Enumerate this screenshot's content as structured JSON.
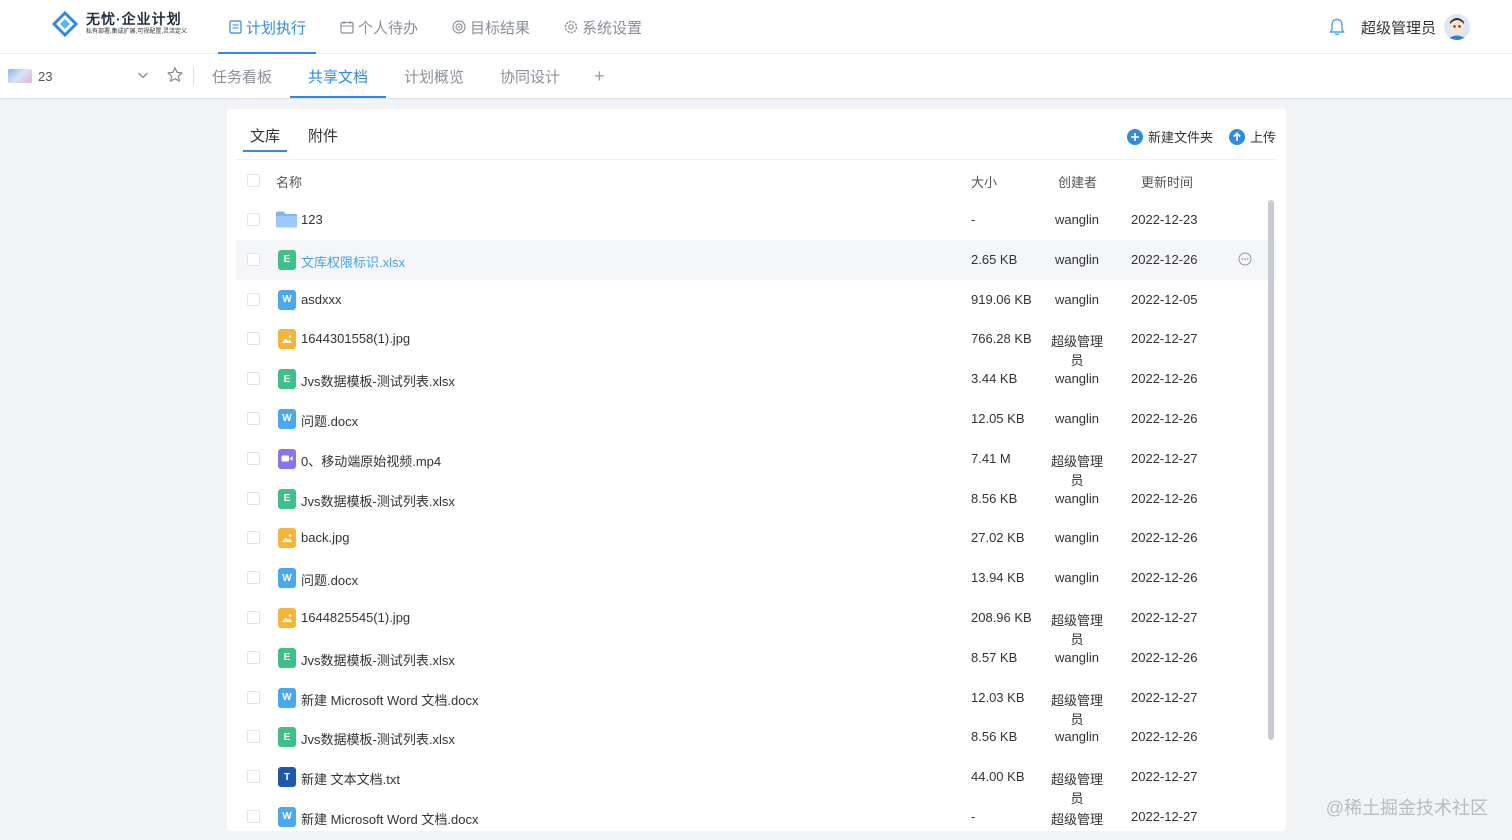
{
  "brand": {
    "title": "无忧·企业计划",
    "subtitle": "私有部署,集成扩展,可视配置,灵活定义"
  },
  "nav": [
    {
      "label": "计划执行",
      "icon": "document-icon",
      "active": true
    },
    {
      "label": "个人待办",
      "icon": "calendar-icon",
      "active": false
    },
    {
      "label": "目标结果",
      "icon": "target-icon",
      "active": false
    },
    {
      "label": "系统设置",
      "icon": "gear-icon",
      "active": false
    }
  ],
  "user": {
    "name": "超级管理员"
  },
  "project": {
    "name": "23"
  },
  "tabs": [
    {
      "label": "任务看板",
      "active": false
    },
    {
      "label": "共享文档",
      "active": true
    },
    {
      "label": "计划概览",
      "active": false
    },
    {
      "label": "协同设计",
      "active": false
    }
  ],
  "tab_add": "+",
  "library_tabs": [
    {
      "label": "文库",
      "active": true
    },
    {
      "label": "附件",
      "active": false
    }
  ],
  "actions": {
    "new_folder": "新建文件夹",
    "upload": "上传"
  },
  "columns": {
    "name": "名称",
    "size": "大小",
    "creator": "创建者",
    "updated": "更新时间"
  },
  "files": [
    {
      "name": "123",
      "type": "folder",
      "size": "-",
      "creator": "wanglin",
      "date": "2022-12-23"
    },
    {
      "name": "文库权限标识.xlsx",
      "type": "excel",
      "size": "2.65 KB",
      "creator": "wanglin",
      "date": "2022-12-26",
      "hover": true
    },
    {
      "name": "asdxxx",
      "type": "word",
      "size": "919.06 KB",
      "creator": "wanglin",
      "date": "2022-12-05"
    },
    {
      "name": "1644301558(1).jpg",
      "type": "image",
      "size": "766.28 KB",
      "creator": "超级管理员",
      "date": "2022-12-27"
    },
    {
      "name": "Jvs数据模板-测试列表.xlsx",
      "type": "excel",
      "size": "3.44 KB",
      "creator": "wanglin",
      "date": "2022-12-26"
    },
    {
      "name": "问题.docx",
      "type": "word",
      "size": "12.05 KB",
      "creator": "wanglin",
      "date": "2022-12-26"
    },
    {
      "name": "0、移动端原始视频.mp4",
      "type": "video",
      "size": "7.41 M",
      "creator": "超级管理员",
      "date": "2022-12-27"
    },
    {
      "name": "Jvs数据模板-测试列表.xlsx",
      "type": "excel",
      "size": "8.56 KB",
      "creator": "wanglin",
      "date": "2022-12-26"
    },
    {
      "name": "back.jpg",
      "type": "image",
      "size": "27.02 KB",
      "creator": "wanglin",
      "date": "2022-12-26"
    },
    {
      "name": "问题.docx",
      "type": "word",
      "size": "13.94 KB",
      "creator": "wanglin",
      "date": "2022-12-26"
    },
    {
      "name": "1644825545(1).jpg",
      "type": "image",
      "size": "208.96 KB",
      "creator": "超级管理员",
      "date": "2022-12-27"
    },
    {
      "name": "Jvs数据模板-测试列表.xlsx",
      "type": "excel",
      "size": "8.57 KB",
      "creator": "wanglin",
      "date": "2022-12-26"
    },
    {
      "name": "新建 Microsoft Word 文档.docx",
      "type": "word",
      "size": "12.03 KB",
      "creator": "超级管理员",
      "date": "2022-12-27"
    },
    {
      "name": "Jvs数据模板-测试列表.xlsx",
      "type": "excel",
      "size": "8.56 KB",
      "creator": "wanglin",
      "date": "2022-12-26"
    },
    {
      "name": "新建 文本文档.txt",
      "type": "text",
      "size": "44.00 KB",
      "creator": "超级管理员",
      "date": "2022-12-27"
    },
    {
      "name": "新建 Microsoft Word 文档.docx",
      "type": "word",
      "size": "-",
      "creator": "超级管理员",
      "date": "2022-12-27"
    }
  ],
  "file_type_badges": {
    "excel": "E",
    "word": "W",
    "text": "T",
    "image": "",
    "video": "",
    "folder": ""
  },
  "file_type_colors": {
    "excel": "#3fbf8a",
    "word": "#4aa8f0",
    "image": "#f5b53a",
    "video": "#8b73f0",
    "text": "#1f5aa8",
    "folder": "#79b5f5"
  },
  "watermark": "@稀土掘金技术社区"
}
